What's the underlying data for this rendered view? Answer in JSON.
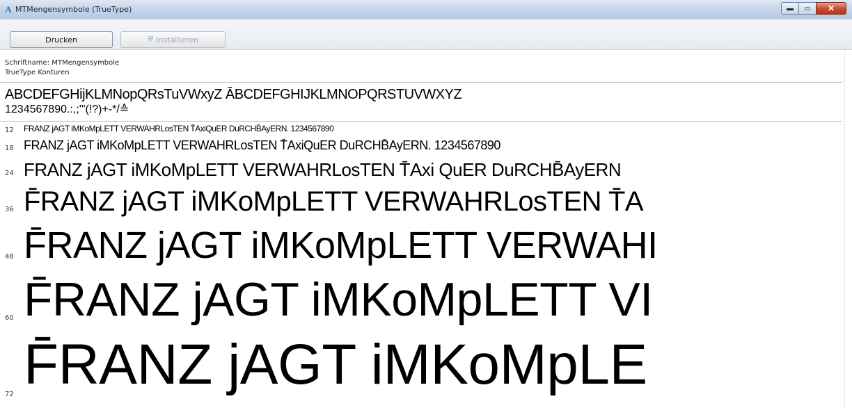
{
  "window": {
    "title": "MTMengensymbole (TrueType)",
    "icon": "font-file-icon",
    "buttons": {
      "minimize": "▬",
      "maximize": "▭",
      "close": "✕"
    }
  },
  "toolbar": {
    "print_label": "Drucken",
    "install_label": "Installieren",
    "install_icon": "shield-icon"
  },
  "info": {
    "font_name": "Schriftname: MTMengensymbole",
    "font_type": "TrueType Konturen"
  },
  "charset": {
    "alphabet": "ABCDEFGHijKLMNopQRsTuVWxyZ ĀBCDEFGHIJKLMNOPQRSTUVWXYZ",
    "digits": "1234567890.:,;'\"(!?)+-*/≙"
  },
  "samples": [
    {
      "size": "12",
      "text": "FRANZ jAGT iMKoMpLETT VERWAHRLosTEN T̄AxiQuER DuRCHB̄AyERN. 1234567890"
    },
    {
      "size": "18",
      "text": "FRANZ jAGT iMKoMpLETT VERWAHRLosTEN T̄AxiQuER DuRCHB̄AyERN. 1234567890"
    },
    {
      "size": "24",
      "text": "FRANZ jAGT iMKoMpLETT VERWAHRLosTEN T̄Axi QuER DuRCHB̄AyERN"
    },
    {
      "size": "36",
      "text": "F̄RANZ jAGT iMKoMpLETT VERWAHRLosTEN T̄A"
    },
    {
      "size": "48",
      "text": "F̄RANZ jAGT iMKoMpLETT VERWAHI"
    },
    {
      "size": "60",
      "text": "F̄RANZ jAGT iMKoMpLETT VI"
    },
    {
      "size": "72",
      "text": "F̄RANZ jAGT iMKoMpLE"
    }
  ]
}
